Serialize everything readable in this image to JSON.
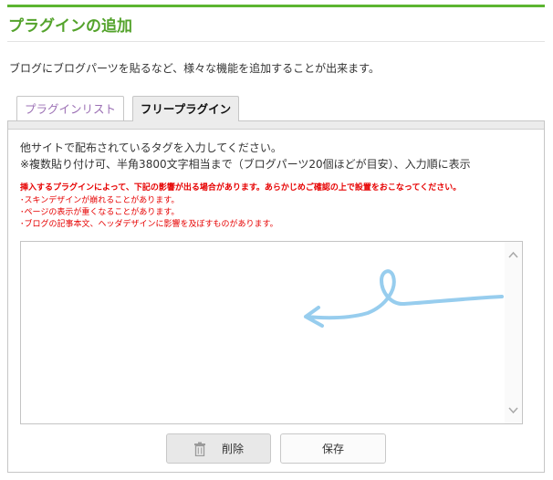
{
  "header": {
    "title": "プラグインの追加",
    "description": "ブログにブログパーツを貼るなど、様々な機能を追加することが出来ます。"
  },
  "tabs": [
    {
      "label": "プラグインリスト",
      "active": false
    },
    {
      "label": "フリープラグイン",
      "active": true
    }
  ],
  "panel": {
    "instruction_1": "他サイトで配布されているタグを入力してください。",
    "instruction_2": "※複数貼り付け可、半角3800文字相当まで（ブログパーツ20個ほどが目安）、入力順に表示",
    "warning_main": "挿入するプラグインによって、下記の影響が出る場合があります。あらかじめご確認の上で設置をおこなってください。",
    "warnings": [
      "･スキンデザインが崩れることがあります。",
      "･ページの表示が重くなることがあります。",
      "･ブログの記事本文、ヘッダデザインに影響を及ぼすものがあります。"
    ],
    "textarea_value": "",
    "buttons": {
      "delete_label": "削除",
      "save_label": "保存"
    }
  },
  "icons": {
    "delete": "trash-icon",
    "scroll_up": "chevron-up-icon",
    "scroll_down": "chevron-down-icon"
  },
  "colors": {
    "accent_green": "#5cb531",
    "title_green": "#54a32c",
    "tab_inactive_text": "#9b6fb4",
    "warning_red": "#e60000",
    "scribble_blue": "#8cc8ec"
  }
}
